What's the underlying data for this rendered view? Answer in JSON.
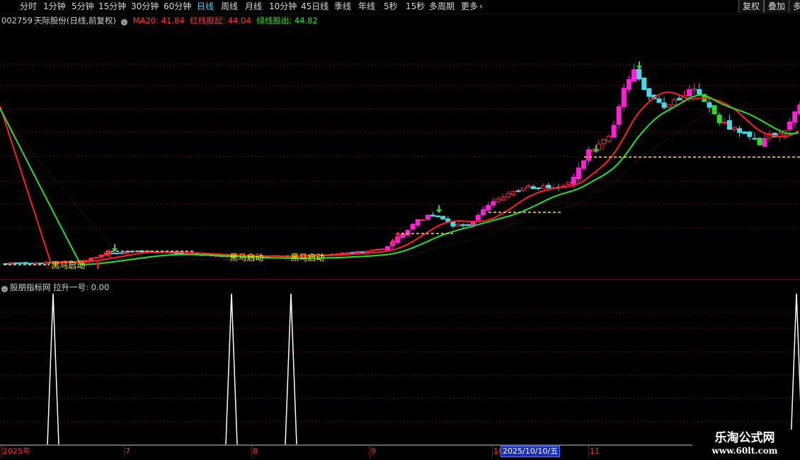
{
  "toolbar": {
    "periods": [
      "分时",
      "1分钟",
      "5分钟",
      "15分钟",
      "30分钟",
      "60分钟",
      "日线",
      "周线",
      "月线",
      "10分钟",
      "45日线",
      "季线",
      "年线",
      "5秒",
      "15秒",
      "多周期",
      "更多"
    ],
    "active_period": "日线",
    "more_arrow": "›",
    "right_buttons": [
      "复权",
      "叠加",
      "多"
    ]
  },
  "main_panel": {
    "stock_code": "002759",
    "stock_name": "天际股份",
    "period_note": "(日线,前复权)",
    "indicators": [
      {
        "label": "MA20: 41.84",
        "color": "#ff3a3a"
      },
      {
        "label": "红线股起: 44.04",
        "color": "#ff3a3a"
      },
      {
        "label": "绿线股出: 44.82",
        "color": "#30e030"
      }
    ],
    "annotations": [
      "黑马启动",
      "黑马启动",
      "黑马启动"
    ]
  },
  "sub_panel": {
    "title": "股朋指标网",
    "indicator": "拉升一号: 0.00"
  },
  "date_axis": {
    "labels": [
      "2025年",
      "7",
      "8",
      "9",
      "10",
      "11"
    ],
    "cursor_date": "2025/10/10/五"
  },
  "watermark": {
    "line1": "乐淘公式网",
    "line2": "www.60lt.com"
  },
  "colors": {
    "up": "#ff2a4a",
    "down": "#4ad8e8",
    "ma_red": "#ff2020",
    "ma_green": "#28e028",
    "magenta": "#ff20d8",
    "grid": "#6a1010"
  },
  "chart_data": {
    "type": "line",
    "x": [
      1,
      2,
      3,
      4,
      5,
      6,
      7,
      8,
      9,
      10,
      11,
      12,
      13,
      14,
      15,
      16,
      17,
      18,
      19,
      20,
      21,
      22,
      23,
      24,
      25,
      26,
      27,
      28,
      29,
      30,
      31,
      32,
      33,
      34,
      35,
      36,
      37,
      38,
      39,
      40,
      41,
      42,
      43,
      44,
      45,
      46,
      47,
      48,
      49,
      50,
      51,
      52,
      53,
      54,
      55,
      56,
      57,
      58,
      59,
      60,
      61,
      62,
      63,
      64,
      65,
      66,
      67,
      68,
      69,
      70,
      71,
      72,
      73,
      74,
      75,
      76,
      77,
      78,
      79,
      80,
      81,
      82,
      83,
      84,
      85,
      86,
      87,
      88,
      89,
      90,
      91,
      92,
      93,
      94,
      95,
      96,
      97,
      98,
      99,
      100,
      101,
      102,
      103,
      104,
      105,
      106,
      107,
      108,
      109,
      110,
      111,
      112,
      113,
      114,
      115,
      116,
      117,
      118,
      119,
      120,
      121,
      122,
      123,
      124,
      125,
      126,
      127,
      128,
      129,
      130,
      131,
      132,
      133,
      134,
      135,
      136,
      137,
      138,
      139,
      140,
      141,
      142,
      143,
      144,
      145,
      146,
      147,
      148,
      149,
      150,
      151,
      152,
      153,
      154,
      155,
      156,
      157,
      158,
      159,
      160
    ],
    "series": [
      {
        "name": "拉升一号",
        "values": [
          0,
          0,
          0,
          0,
          0,
          0,
          0,
          0,
          0,
          1,
          0,
          0,
          0,
          0,
          0,
          0,
          0,
          0,
          0,
          0,
          0,
          0,
          0,
          0,
          0,
          0,
          0,
          0,
          0,
          0,
          0,
          0,
          0,
          0,
          0,
          0,
          0,
          0,
          0,
          0,
          0,
          0,
          0,
          0,
          0,
          1,
          0,
          0,
          0,
          0,
          0,
          0,
          0,
          0,
          0,
          0,
          0,
          1,
          0,
          0,
          0,
          0,
          0,
          0,
          0,
          0,
          0,
          0,
          0,
          0,
          0,
          0,
          0,
          0,
          0,
          0,
          0,
          0,
          0,
          0,
          0,
          0,
          0,
          0,
          0,
          0,
          0,
          0,
          0,
          0,
          0,
          0,
          0,
          0,
          0,
          0,
          0,
          0,
          0,
          0,
          0,
          0,
          0,
          0,
          0,
          0,
          0,
          0,
          0,
          0,
          0,
          0,
          0,
          0,
          0,
          0,
          0,
          0,
          0,
          0,
          0,
          0,
          0,
          0,
          0,
          0,
          0,
          0,
          0,
          0,
          0,
          0,
          0,
          0,
          0,
          0,
          0,
          0,
          0,
          0,
          0,
          0,
          0,
          0,
          0,
          0,
          0,
          0,
          0,
          0,
          0,
          0,
          0,
          0,
          0,
          0,
          0,
          0,
          0,
          1
        ]
      }
    ],
    "ylim": [
      0,
      1
    ],
    "grid": true
  }
}
